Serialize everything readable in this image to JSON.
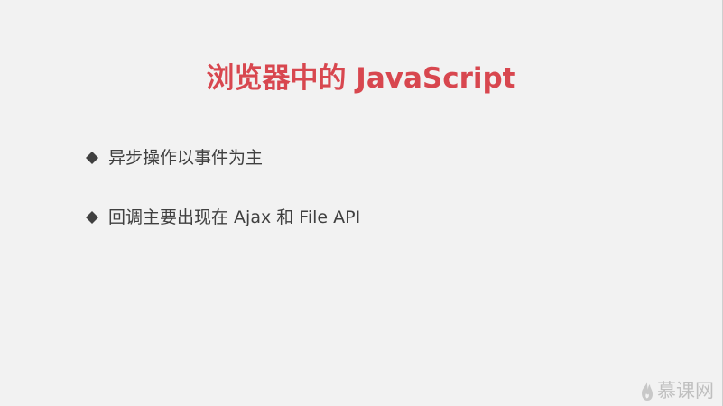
{
  "slide": {
    "title": "浏览器中的 JavaScript",
    "bullets": [
      {
        "text": "异步操作以事件为主",
        "icon": "diamond-bullet-icon"
      },
      {
        "text": "回调主要出现在 Ajax 和 File API",
        "icon": "diamond-bullet-icon"
      }
    ],
    "watermark": {
      "text": "慕课网",
      "icon": "flame-logo-icon"
    },
    "colors": {
      "title": "#d8474f",
      "body_text": "#404040",
      "background": "#f2f2f2",
      "watermark": "#bfbfbf"
    }
  }
}
